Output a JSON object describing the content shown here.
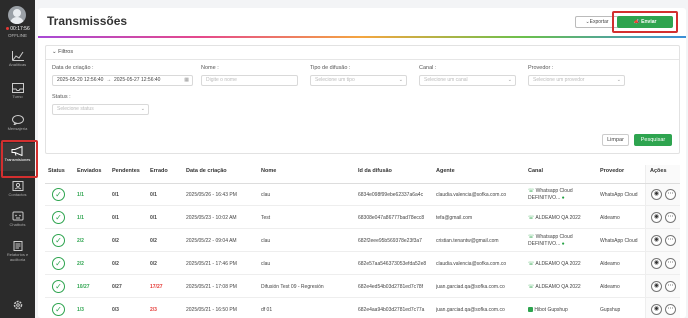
{
  "sidebar": {
    "time": "00:17:56",
    "status": "OFFLINE",
    "items": [
      {
        "label": "Analíticas",
        "icon": "chart-icon"
      },
      {
        "label": "Turno",
        "icon": "inbox-icon"
      },
      {
        "label": "Mensajería",
        "icon": "chat-icon"
      },
      {
        "label": "Transmisiones",
        "icon": "megaphone-icon"
      },
      {
        "label": "Contactos",
        "icon": "contacts-icon"
      },
      {
        "label": "Chatbots",
        "icon": "bot-icon"
      },
      {
        "label": "Relatorios e auditoria",
        "icon": "reports-icon"
      },
      {
        "label": "",
        "icon": "gear-icon"
      }
    ]
  },
  "header": {
    "title": "Transmissões",
    "export_label": "Exportar",
    "send_label": "Enviar transmissões"
  },
  "filters": {
    "title": "Filtros",
    "date_label": "Data de criação",
    "date_from": "2025-05-20 12:56:40",
    "date_to": "2025-05-27 12:56:40",
    "name_label": "Nome",
    "name_placeholder": "Digite o nome",
    "type_label": "Tipo de difusão",
    "type_placeholder": "Selecione um tipo",
    "channel_label": "Canal",
    "channel_placeholder": "Selecione um canal",
    "provider_label": "Provedor",
    "provider_placeholder": "Selecione um provedor",
    "status_label": "Status",
    "status_placeholder": "Selecione status",
    "clear_label": "Limpar",
    "search_label": "Pesquisar"
  },
  "table": {
    "headers": [
      "Status",
      "Enviados",
      "Pendentes",
      "Errado",
      "Data de criação",
      "Nome",
      "Id da difusão",
      "Agente",
      "Canal",
      "Provedor",
      "Ações"
    ],
    "rows": [
      {
        "enviados": "1/1",
        "pendentes": "0/1",
        "errado": "0/1",
        "data": "2025/05/26 - 16:43 PM",
        "nome": "clau",
        "id": "6834e098f99ebe62337a6a4c",
        "agente": "claudia.valencia@sofka.com.co",
        "canal1": "Whatsapp Cloud",
        "canal2": "DEFINITIVO...",
        "provedor": "WhatsApp Cloud"
      },
      {
        "enviados": "1/1",
        "pendentes": "0/1",
        "errado": "0/1",
        "data": "2025/05/23 - 10:02 AM",
        "nome": "Test",
        "id": "68308e047a86777bad78ecc8",
        "agente": "tefa@gmail.com",
        "canal1": "ALDEAMO QA 2022",
        "canal2": "",
        "provedor": "Aldeamo"
      },
      {
        "enviados": "2/2",
        "pendentes": "0/2",
        "errado": "0/2",
        "data": "2025/05/22 - 09:04 AM",
        "nome": "clau",
        "id": "682f2eee95b569378e23f3a7",
        "agente": "cristian.tenantw@gmail.com",
        "canal1": "Whatsapp Cloud",
        "canal2": "DEFINITIVO...",
        "provedor": "WhatsApp Cloud"
      },
      {
        "enviados": "2/2",
        "pendentes": "0/2",
        "errado": "0/2",
        "data": "2025/05/21 - 17:46 PM",
        "nome": "clau",
        "id": "682e57aa546373053efda52e8",
        "agente": "claudia.valencia@sofka.com.co",
        "canal1": "ALDEAMO QA 2022",
        "canal2": "",
        "provedor": "Aldeamo"
      },
      {
        "enviados": "10/27",
        "pendentes": "0/27",
        "errado": "17/27",
        "data": "2025/05/21 - 17:08 PM",
        "nome": "Difusión Test 09 - Regresión",
        "id": "682e4ed54b03d2781ed7c78f",
        "agente": "juan.garciad.qa@sofka.com.co",
        "canal1": "ALDEAMO QA 2022",
        "canal2": "",
        "provedor": "Aldeamo"
      },
      {
        "enviados": "1/3",
        "pendentes": "0/3",
        "errado": "2/3",
        "data": "2025/05/21 - 16:50 PM",
        "nome": "df 01",
        "id": "682e4aa94b03d2781ed7c77a",
        "agente": "juan.garciad.qa@sofka.com.co",
        "canal1": "Hibot Gupshup",
        "canal2": "",
        "provedor": "Gupshup"
      }
    ]
  }
}
